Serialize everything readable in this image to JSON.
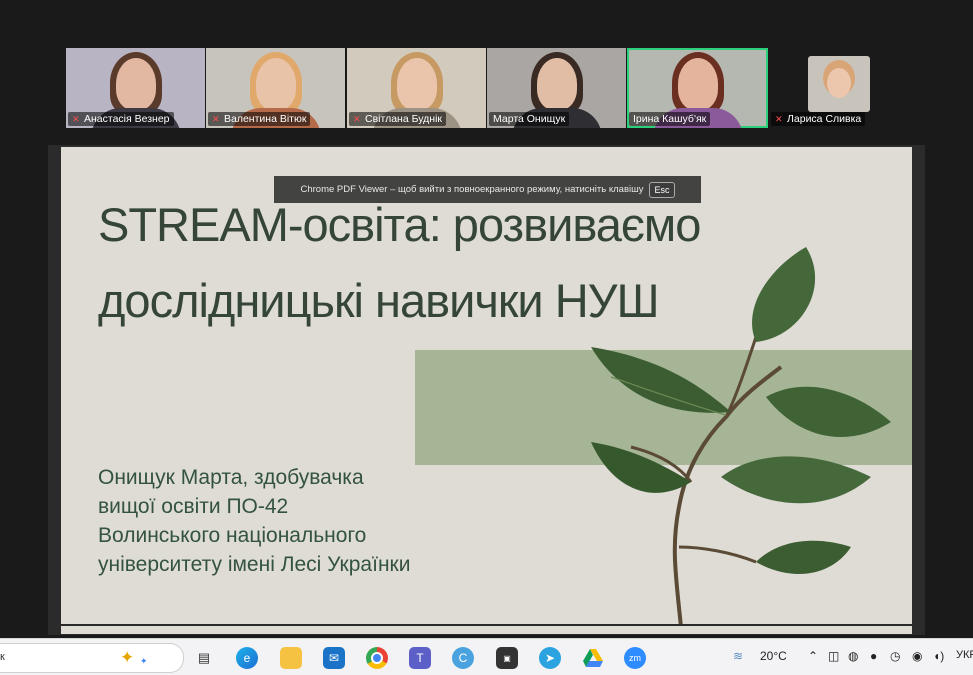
{
  "participants": [
    {
      "name": "Анастасія Везнер",
      "muted": true
    },
    {
      "name": "Валентина Вітюк",
      "muted": true
    },
    {
      "name": "Світлана Буднік",
      "muted": true
    },
    {
      "name": "Марта Онищук",
      "muted": false
    },
    {
      "name": "Ірина Кашуб'як",
      "muted": false,
      "active": true
    },
    {
      "name": "Лариса Сливка",
      "muted": true
    }
  ],
  "pdf_toast": {
    "message": "Chrome PDF Viewer – щоб вийти з повноекранного режиму, натисніть клавішу",
    "key": "Esc"
  },
  "slide": {
    "title": "STREAM-освіта: розвиваємо дослідницькі навички НУШ",
    "author_lines": [
      "Онищук Марта, здобувачка",
      "вищої освіти ПО-42",
      "Волинського національного",
      "університету імені Лесі Українки"
    ]
  },
  "taskbar": {
    "search_text": "к",
    "apps": [
      "copilot-icon",
      "task-view-icon",
      "edge-icon",
      "file-explorer-icon",
      "outlook-icon",
      "chrome-icon",
      "teams-icon",
      "ccleaner-icon",
      "mirillis-icon",
      "telegram-icon",
      "google-drive-icon",
      "zoom-icon"
    ],
    "temperature": "20°C",
    "language": "УКР"
  },
  "colors": {
    "active_speaker": "#2ccf7a",
    "slide_bg": "#dedcd5",
    "slide_text": "#354537",
    "band": "#a5b596"
  }
}
